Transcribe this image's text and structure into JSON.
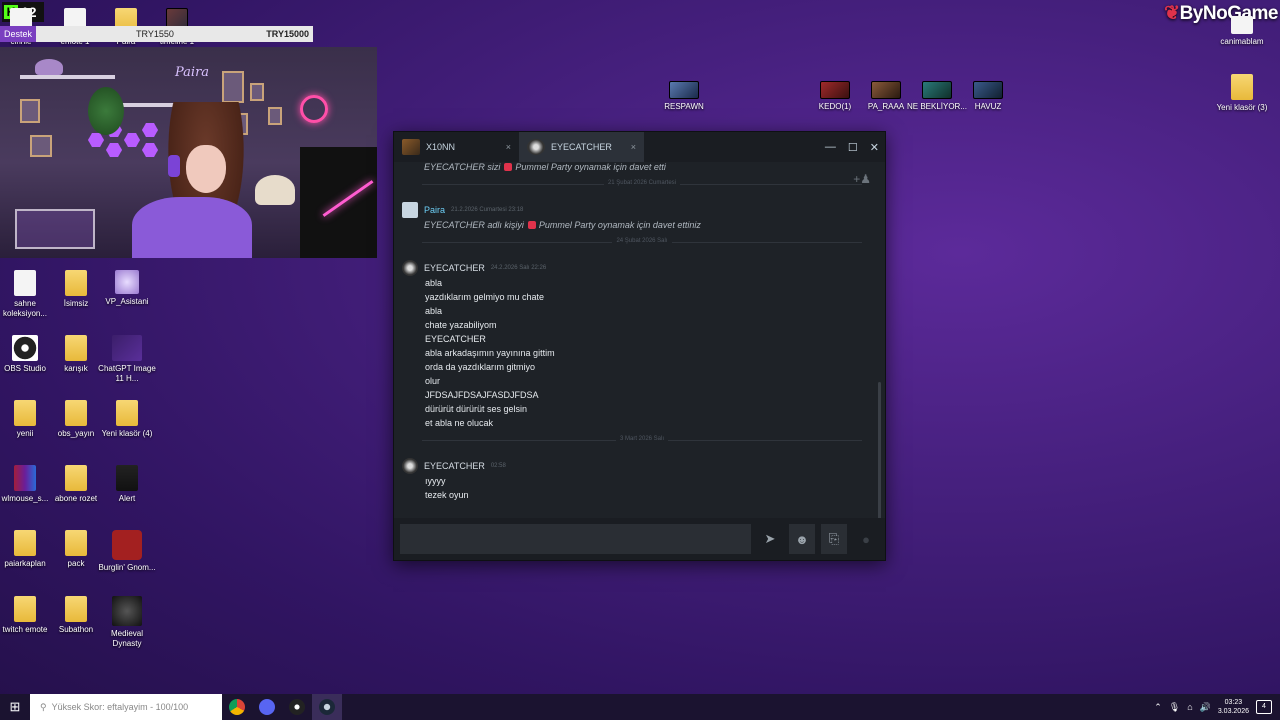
{
  "overlay": {
    "kick_count": "12",
    "donate_label": "Destek",
    "donate_amount": "TRY1550",
    "donate_goal": "TRY15000",
    "brand": "ByNoGame",
    "partial_labels": [
      "cinnie",
      "emote 1",
      "Paira",
      "timeline 1"
    ]
  },
  "desktop_icons_left": [
    {
      "label": "sahne koleksiyon...",
      "icon": "file-icon"
    },
    {
      "label": "İsimsiz",
      "icon": "folder-icon"
    },
    {
      "label": "VP_Asistani",
      "icon": "assistant-icon"
    },
    {
      "label": "OBS Studio",
      "icon": "obs-icon"
    },
    {
      "label": "karışık",
      "icon": "folder-icon"
    },
    {
      "label": "ChatGPT Image 11 H...",
      "icon": "image-icon"
    },
    {
      "label": "yenii",
      "icon": "folder-icon"
    },
    {
      "label": "obs_yayın",
      "icon": "folder-icon"
    },
    {
      "label": "Yeni klasör (4)",
      "icon": "folder-icon"
    },
    {
      "label": "wlmouse_s...",
      "icon": "archive-icon"
    },
    {
      "label": "abone rozet",
      "icon": "folder-icon"
    },
    {
      "label": "Alert",
      "icon": "folder-icon"
    },
    {
      "label": "paiarkaplan",
      "icon": "folder-icon"
    },
    {
      "label": "pack",
      "icon": "folder-icon"
    },
    {
      "label": "Burglin' Gnom...",
      "icon": "game-icon"
    },
    {
      "label": "twitch emote",
      "icon": "folder-icon"
    },
    {
      "label": "Subathon",
      "icon": "folder-icon"
    },
    {
      "label": "Medieval Dynasty",
      "icon": "game-icon"
    }
  ],
  "desktop_icons_top": [
    {
      "label": "RESPAWN"
    },
    {
      "label": "KEDO(1)"
    },
    {
      "label": "PA_RAAA"
    },
    {
      "label": "NE BEKLİYOR..."
    },
    {
      "label": "HAVUZ"
    },
    {
      "label": "canimablam"
    },
    {
      "label": "Yeni klasör (3)"
    }
  ],
  "steam_chat": {
    "tabs": [
      {
        "name": "X10NN",
        "close": "×"
      },
      {
        "name": "EYECATCHER",
        "close": "×"
      }
    ],
    "window_controls": {
      "minimize": "—",
      "maximize": "☐",
      "close": "✕"
    },
    "top_system_line": {
      "text_a": "EYECATCHER sizi",
      "text_b": "Pummel Party oynamak için davet etti"
    },
    "date_sep_1": "21 Şubat 2026 Cumartesi",
    "me_message": {
      "name": "Paira",
      "time": "21.2.2026 Cumartesi 23:18",
      "text_a": "EYECATCHER adlı kişiyi",
      "text_b": "Pummel Party oynamak için davet ettiniz"
    },
    "date_sep_2": "24 Şubat 2026 Salı",
    "group1": {
      "name": "EYECATCHER",
      "time": "24.2.2026 Salı 22:26",
      "lines": [
        "abla",
        "yazdıklarım gelmiyo mu chate",
        "abla",
        "chate yazabiliyom",
        "EYECATCHER",
        "abla arkadaşımın yayınına gittim",
        "orda da yazdıklarım gitmiyo",
        "olur",
        "JFDSAJFDSAJFASDJFDSA",
        "dürürüt dürürüt ses gelsin",
        "et abla ne olucak"
      ]
    },
    "date_sep_3": "3 Mart 2026 Salı",
    "group2": {
      "name": "EYECATCHER",
      "time": "02:58",
      "lines": [
        "ıyyyy",
        "tezek oyun"
      ]
    },
    "input": {
      "value": "",
      "placeholder": ""
    },
    "send_icon": "➤",
    "emoji_icon": "☻",
    "attach_icon": "⎘"
  },
  "taskbar": {
    "search_text": "Yüksek Skor: eftalyayim - 100/100",
    "clock_time": "03:23",
    "clock_date": "3.03.2026",
    "notification_count": "4"
  }
}
